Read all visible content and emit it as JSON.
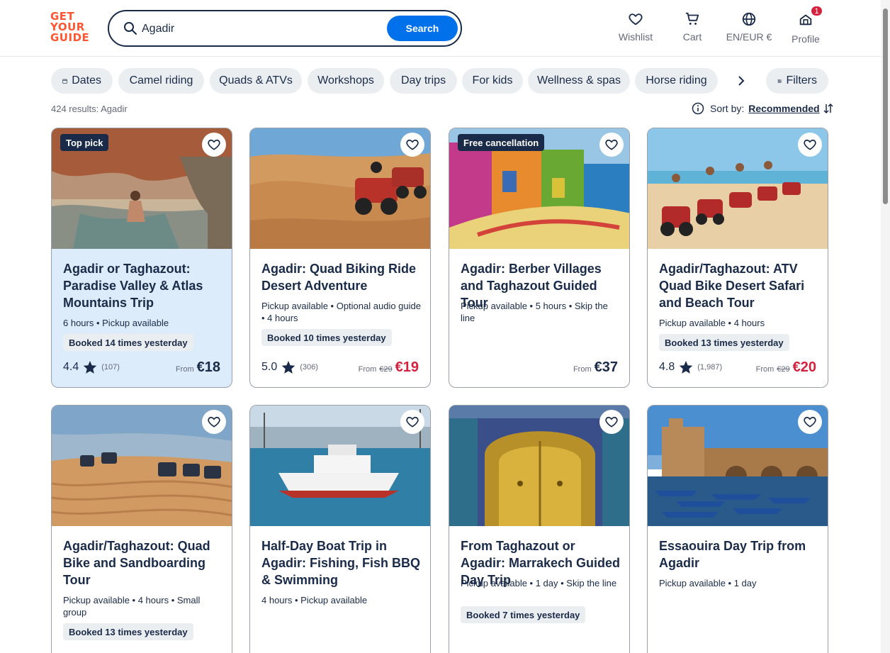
{
  "header": {
    "logo_lines": [
      "GET",
      "YOUR",
      "GUIDE"
    ],
    "search": {
      "value": "Agadir",
      "button": "Search"
    },
    "nav": [
      {
        "label": "Wishlist",
        "icon": "heart-icon"
      },
      {
        "label": "Cart",
        "icon": "cart-icon"
      },
      {
        "label": "EN/EUR €",
        "icon": "globe-icon"
      },
      {
        "label": "Profile",
        "icon": "profile-icon",
        "badge": "1"
      }
    ]
  },
  "chips": [
    "Dates",
    "Camel riding",
    "Quads & ATVs",
    "Workshops",
    "Day trips",
    "For kids",
    "Wellness & spas",
    "Horse riding",
    "Filters"
  ],
  "results": {
    "count_text": "424 results: Agadir",
    "sort_label": "Sort by:",
    "sort_value": "Recommended"
  },
  "cards": [
    {
      "tag": "Top pick",
      "title": "Agadir or Taghazout: Paradise Valley & Atlas Mountains Trip",
      "meta": "6 hours • Pickup available",
      "booked": "Booked 14 times yesterday",
      "rating": "4.4",
      "reviews": "(107)",
      "from": "From",
      "price": "€18"
    },
    {
      "title": "Agadir: Quad Biking Ride Desert Adventure",
      "meta": "Pickup available • Optional audio guide • 4 hours",
      "booked": "Booked 10 times yesterday",
      "rating": "5.0",
      "reviews": "(306)",
      "from": "From",
      "old_price": "€29",
      "price": "€19"
    },
    {
      "tag": "Free cancellation",
      "title": "Agadir: Berber Villages and Taghazout Guided Tour",
      "meta": "Pickup available • 5 hours • Skip the line",
      "from": "From",
      "price": "€37"
    },
    {
      "title": "Agadir/Taghazout: ATV Quad Bike Desert Safari and Beach Tour",
      "meta": "Pickup available • 4 hours",
      "booked": "Booked 13 times yesterday",
      "rating": "4.8",
      "reviews": "(1,987)",
      "from": "From",
      "old_price": "€29",
      "price": "€20"
    },
    {
      "title": "Agadir/Taghazout: Quad Bike and Sandboarding Tour",
      "meta": "Pickup available • 4 hours • Small group",
      "booked": "Booked 13 times yesterday"
    },
    {
      "title": "Half-Day Boat Trip in Agadir: Fishing, Fish BBQ & Swimming",
      "meta": "4 hours • Pickup available"
    },
    {
      "title": "From Taghazout or Agadir: Marrakech Guided Day Trip",
      "meta": "Pickup available • 1 day • Skip the line",
      "booked": "Booked 7 times yesterday"
    },
    {
      "title": "Essaouira Day Trip from Agadir",
      "meta": "Pickup available • 1 day"
    }
  ],
  "colors": {
    "brand": "#ff5533",
    "primary": "#0071eb",
    "text": "#1a2b49",
    "sale": "#d4213d",
    "highlight_card": "#dcecfb"
  }
}
